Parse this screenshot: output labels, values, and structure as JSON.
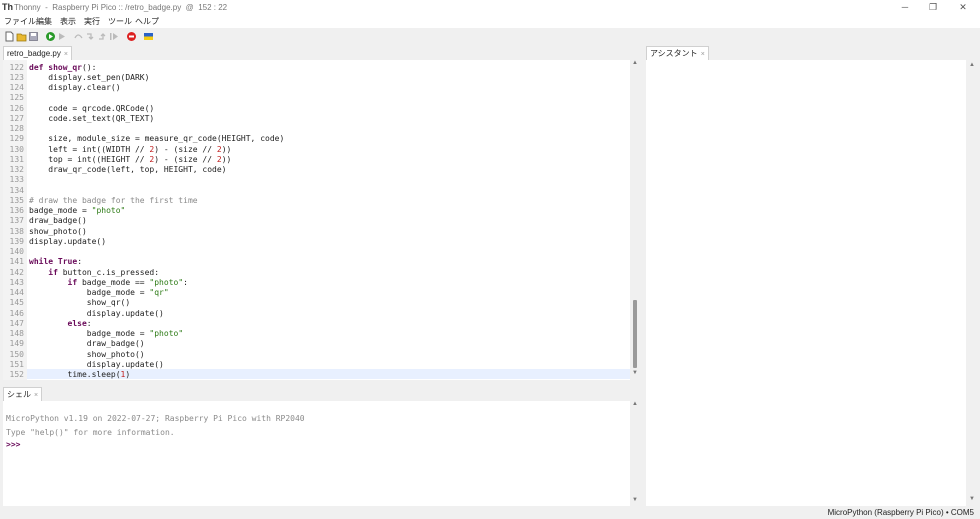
{
  "window": {
    "title": "Thonny  -  Raspberry Pi Pico :: /retro_badge.py  @  152 : 22",
    "minimize": "─",
    "maximize": "❐",
    "close": "✕"
  },
  "menu": [
    "ファイル",
    "編集",
    "表示",
    "実行",
    "ツール",
    "ヘルプ"
  ],
  "editor": {
    "tab_label": "retro_badge.py",
    "lines": [
      {
        "n": "122",
        "html": "<span class=\"kw\">def</span> <span class=\"kw\">show_qr</span>():"
      },
      {
        "n": "123",
        "html": "    display.set_pen(DARK)"
      },
      {
        "n": "124",
        "html": "    display.clear()"
      },
      {
        "n": "125",
        "html": ""
      },
      {
        "n": "126",
        "html": "    code = qrcode.QRCode()"
      },
      {
        "n": "127",
        "html": "    code.set_text(QR_TEXT)"
      },
      {
        "n": "128",
        "html": ""
      },
      {
        "n": "129",
        "html": "    size, module_size = measure_qr_code(HEIGHT, code)"
      },
      {
        "n": "130",
        "html": "    left = int((WIDTH // <span class=\"num\">2</span>) - (size // <span class=\"num\">2</span>))"
      },
      {
        "n": "131",
        "html": "    top = int((HEIGHT // <span class=\"num\">2</span>) - (size // <span class=\"num\">2</span>))"
      },
      {
        "n": "132",
        "html": "    draw_qr_code(left, top, HEIGHT, code)"
      },
      {
        "n": "133",
        "html": ""
      },
      {
        "n": "134",
        "html": ""
      },
      {
        "n": "135",
        "html": "<span class=\"cmt\"># draw the badge for the first time</span>"
      },
      {
        "n": "136",
        "html": "badge_mode = <span class=\"str\">\"photo\"</span>"
      },
      {
        "n": "137",
        "html": "draw_badge()"
      },
      {
        "n": "138",
        "html": "show_photo()"
      },
      {
        "n": "139",
        "html": "display.update()"
      },
      {
        "n": "140",
        "html": ""
      },
      {
        "n": "141",
        "html": "<span class=\"kw\">while</span> <span class=\"kw\">True</span>:"
      },
      {
        "n": "142",
        "html": "    <span class=\"kw\">if</span> button_c.is_pressed:"
      },
      {
        "n": "143",
        "html": "        <span class=\"kw\">if</span> badge_mode == <span class=\"str\">\"photo\"</span>:"
      },
      {
        "n": "144",
        "html": "            badge_mode = <span class=\"str\">\"qr\"</span>"
      },
      {
        "n": "145",
        "html": "            show_qr()"
      },
      {
        "n": "146",
        "html": "            display.update()"
      },
      {
        "n": "147",
        "html": "        <span class=\"kw\">else</span>:"
      },
      {
        "n": "148",
        "html": "            badge_mode = <span class=\"str\">\"photo\"</span>"
      },
      {
        "n": "149",
        "html": "            draw_badge()"
      },
      {
        "n": "150",
        "html": "            show_photo()"
      },
      {
        "n": "151",
        "html": "            display.update()"
      },
      {
        "n": "152",
        "html": "        time.sleep(<span class=\"num\">1</span>)"
      }
    ]
  },
  "shell": {
    "tab_label": "シェル",
    "lines": [
      "MicroPython v1.19 on 2022-07-27; Raspberry Pi Pico with RP2040",
      "Type \"help()\" for more information."
    ],
    "prompt": ">>>"
  },
  "assistant": {
    "tab_label": "アシスタント"
  },
  "status": "MicroPython (Raspberry Pi Pico)  •  COM5",
  "colors": {
    "keyword": "#6a0b5a",
    "string": "#2b7a14",
    "number": "#c02020",
    "comment": "#8a8a8a"
  }
}
